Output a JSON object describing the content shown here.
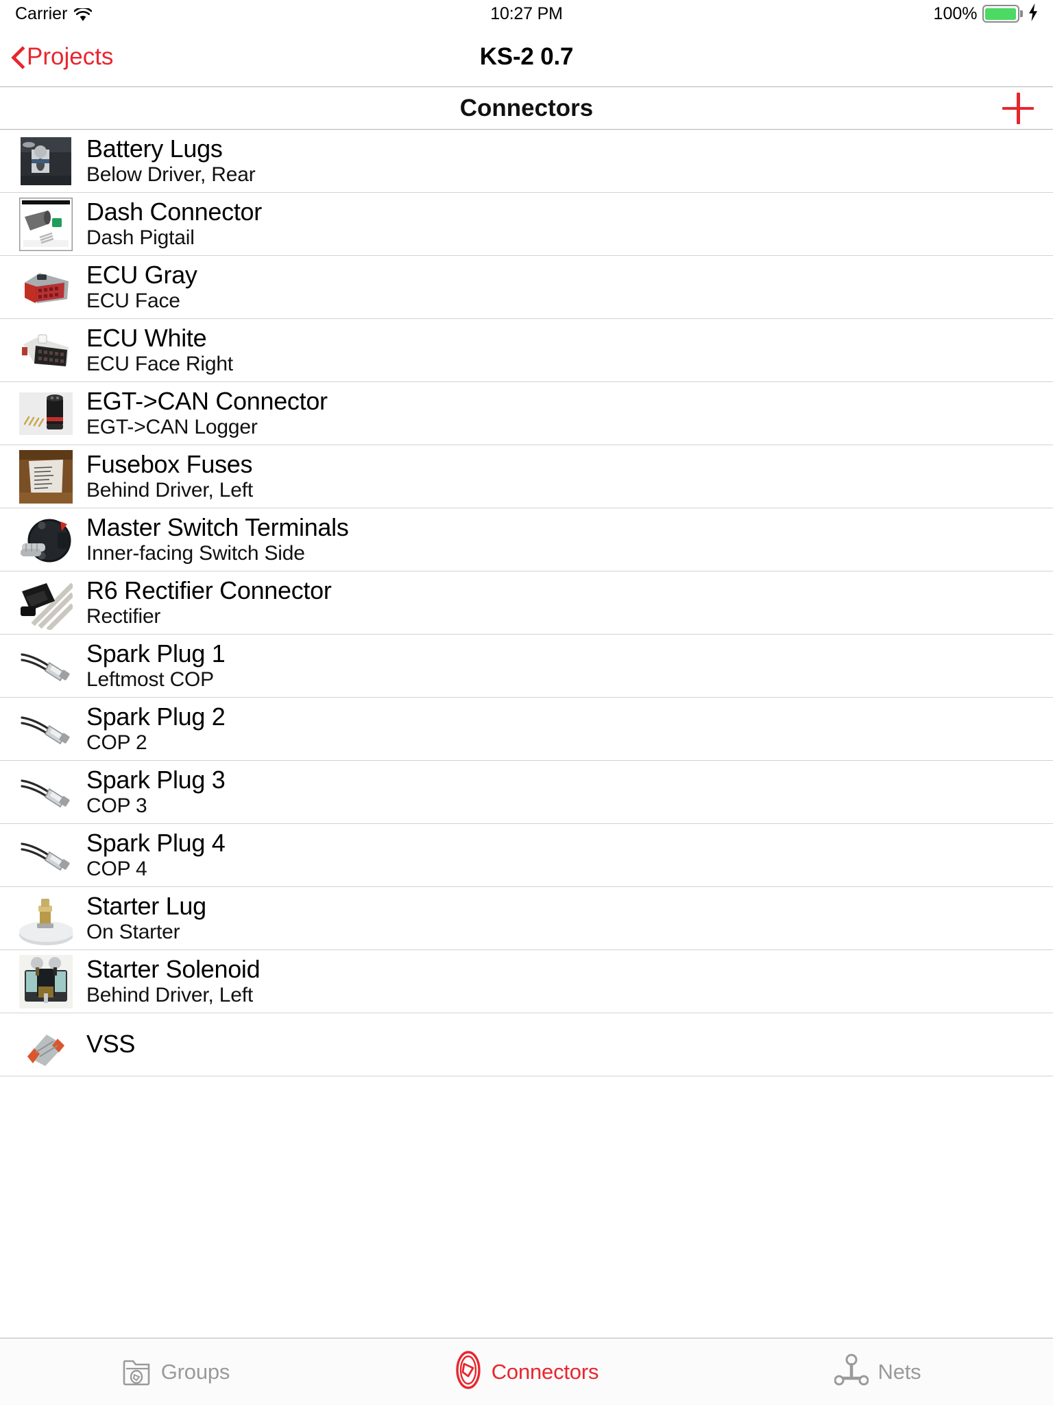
{
  "status_bar": {
    "carrier": "Carrier",
    "wifi_icon": "wifi-icon",
    "time": "10:27 PM",
    "battery_percent": "100%",
    "battery_icon": "battery-full-icon",
    "charging_icon": "lightning-bolt-icon",
    "battery_color": "#4cd964"
  },
  "nav_bar": {
    "back_label": "Projects",
    "back_icon": "chevron-left-icon",
    "title": "KS-2 0.7",
    "accent_color": "#e8262d"
  },
  "section_header": {
    "title": "Connectors",
    "add_icon": "plus-icon"
  },
  "list": {
    "rows": [
      {
        "title": "Battery Lugs",
        "subtitle": "Below Driver, Rear",
        "thumb": "battery-lug-photo"
      },
      {
        "title": "Dash Connector",
        "subtitle": "Dash Pigtail",
        "thumb": "dash-connector-photo"
      },
      {
        "title": "ECU Gray",
        "subtitle": "ECU Face",
        "thumb": "ecu-gray-connector-photo"
      },
      {
        "title": "ECU White",
        "subtitle": "ECU Face Right",
        "thumb": "ecu-white-connector-photo"
      },
      {
        "title": "EGT->CAN Connector",
        "subtitle": "EGT->CAN Logger",
        "thumb": "egt-can-connector-photo"
      },
      {
        "title": "Fusebox Fuses",
        "subtitle": "Behind Driver, Left",
        "thumb": "fusebox-photo"
      },
      {
        "title": "Master Switch Terminals",
        "subtitle": "Inner-facing Switch Side",
        "thumb": "master-switch-photo"
      },
      {
        "title": "R6 Rectifier Connector",
        "subtitle": "Rectifier",
        "thumb": "r6-rectifier-photo"
      },
      {
        "title": "Spark Plug 1",
        "subtitle": "Leftmost COP",
        "thumb": "spark-plug-photo"
      },
      {
        "title": "Spark Plug 2",
        "subtitle": "COP 2",
        "thumb": "spark-plug-photo"
      },
      {
        "title": "Spark Plug 3",
        "subtitle": "COP 3",
        "thumb": "spark-plug-photo"
      },
      {
        "title": "Spark Plug 4",
        "subtitle": "COP 4",
        "thumb": "spark-plug-photo"
      },
      {
        "title": "Starter Lug",
        "subtitle": "On Starter",
        "thumb": "starter-lug-photo"
      },
      {
        "title": "Starter Solenoid",
        "subtitle": "Behind Driver, Left",
        "thumb": "starter-solenoid-photo"
      },
      {
        "title": "VSS",
        "subtitle": "",
        "thumb": "vss-connector-photo"
      }
    ]
  },
  "tab_bar": {
    "tabs": [
      {
        "label": "Groups",
        "icon": "folder-connector-icon",
        "active": false
      },
      {
        "label": "Connectors",
        "icon": "connector-oval-icon",
        "active": true
      },
      {
        "label": "Nets",
        "icon": "net-nodes-icon",
        "active": false
      }
    ],
    "active_color": "#e8262d",
    "inactive_color": "#9a9a9a"
  }
}
